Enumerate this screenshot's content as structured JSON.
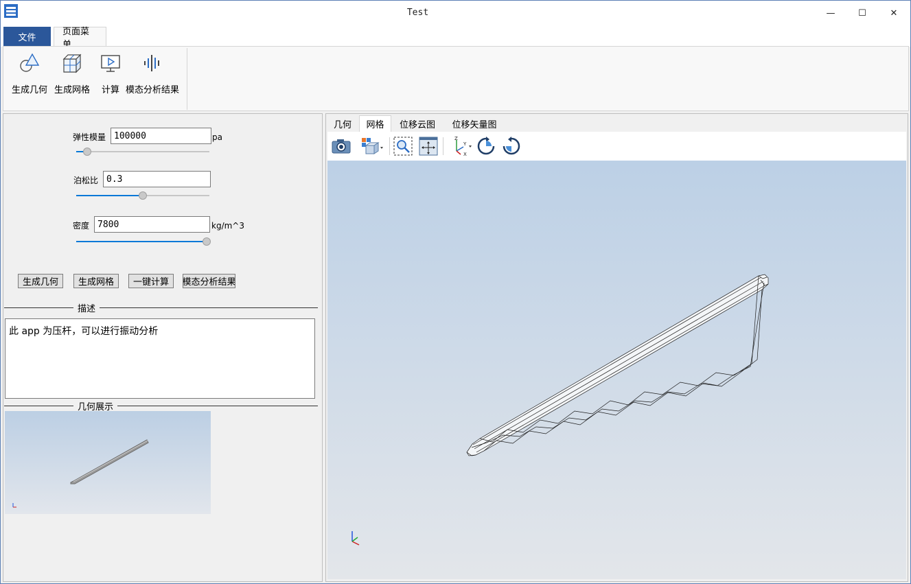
{
  "window": {
    "title": "Test",
    "minimize_glyph": "—",
    "maximize_glyph": "☐",
    "close_glyph": "✕"
  },
  "ribbon": {
    "tabs": [
      {
        "label": "文件"
      },
      {
        "label": "页面菜单"
      }
    ],
    "buttons": [
      {
        "label": "生成几何",
        "icon": "geometry-icon"
      },
      {
        "label": "生成网格",
        "icon": "mesh-icon"
      },
      {
        "label": "计算",
        "icon": "compute-icon"
      },
      {
        "label": "模态分析结果",
        "icon": "modal-results-icon"
      }
    ]
  },
  "params": {
    "elastic": {
      "label": "弹性模量",
      "value": "100000",
      "unit": "pa",
      "slider_fraction": 0.08
    },
    "poisson": {
      "label": "泊松比",
      "value": "0.3",
      "unit": "",
      "slider_fraction": 0.5
    },
    "density": {
      "label": "密度",
      "value": "7800",
      "unit": "kg/m^3",
      "slider_fraction": 0.98
    }
  },
  "actions": [
    {
      "label": "生成几何"
    },
    {
      "label": "生成网格"
    },
    {
      "label": "一键计算"
    },
    {
      "label": "模态分析结果"
    }
  ],
  "description": {
    "title": "描述",
    "text": "此 app 为压杆，可以进行振动分析"
  },
  "geometry_preview": {
    "title": "几何展示"
  },
  "view_tabs": [
    {
      "label": "几何"
    },
    {
      "label": "网格"
    },
    {
      "label": "位移云图"
    },
    {
      "label": "位移矢量图"
    }
  ],
  "view_active_tab": "网格",
  "toolbar_icons": [
    "camera-icon",
    "view-cube-icon",
    "zoom-box-icon",
    "fit-view-icon",
    "axes-orientation-icon",
    "rotate-cw-icon",
    "rotate-ccw-icon"
  ],
  "colors": {
    "accent": "#2b579a",
    "slider_fill": "#0078d7",
    "viewport_top": "#bcd0e6",
    "viewport_bottom": "#e3e6ea"
  }
}
